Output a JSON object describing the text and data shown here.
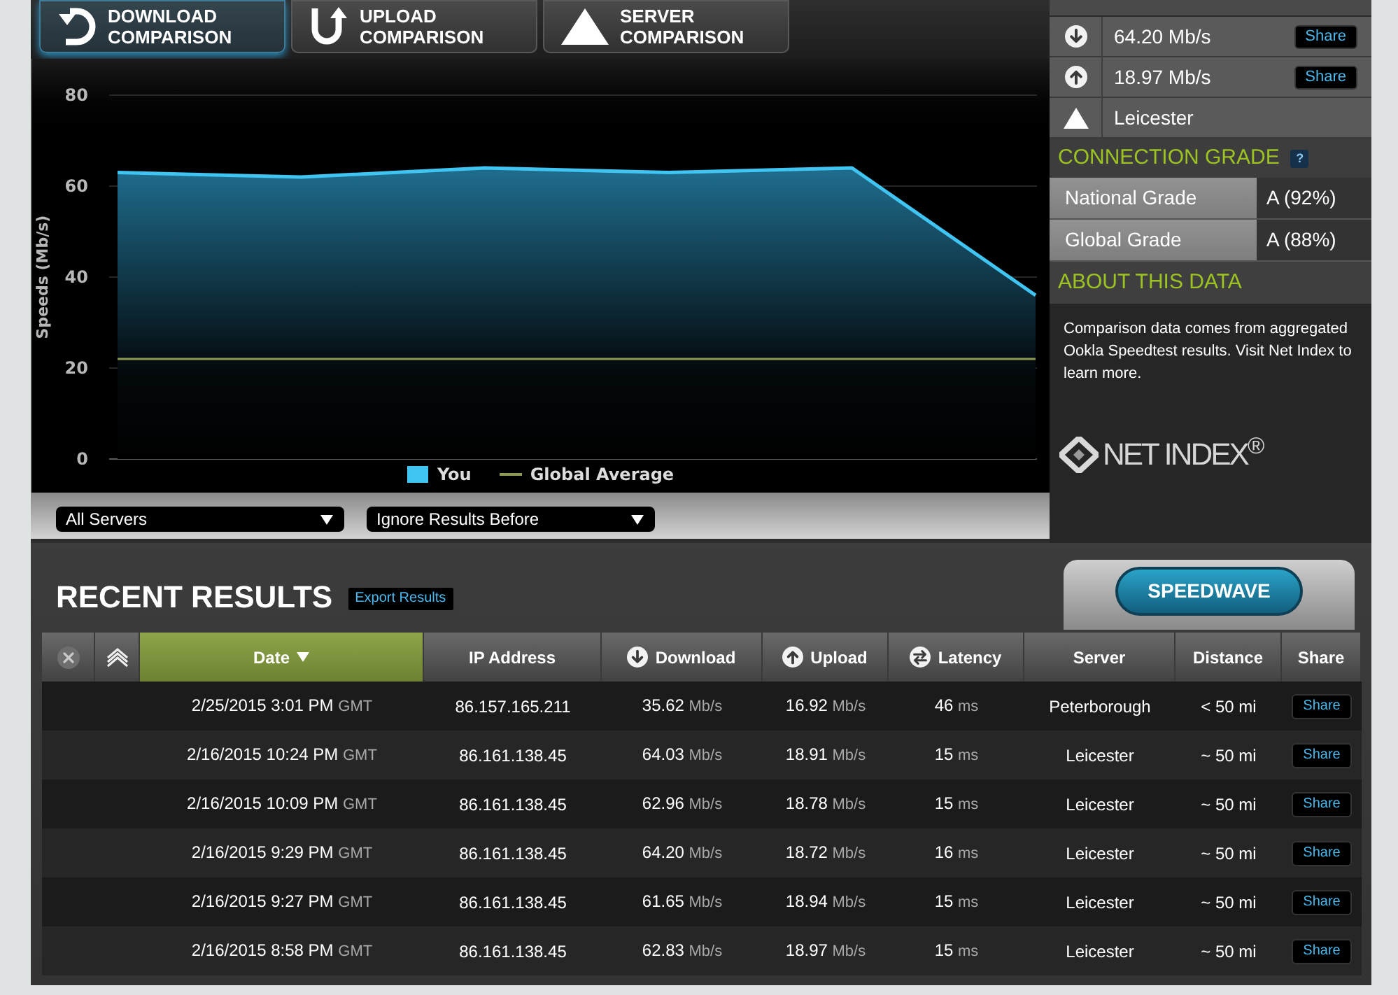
{
  "comparison_tabs": [
    {
      "kind": "download",
      "label": "DOWNLOAD COMPARISON",
      "selected": true
    },
    {
      "kind": "upload",
      "label": "UPLOAD COMPARISON",
      "selected": false
    },
    {
      "kind": "server",
      "label": "SERVER COMPARISON",
      "selected": false
    }
  ],
  "chart": {
    "chart_data": {
      "type": "area",
      "ylabel": "Speeds (Mb/s)",
      "ylim": [
        0,
        80
      ],
      "yticks": [
        0,
        20,
        40,
        60,
        80
      ],
      "grid": true,
      "legend": true,
      "series": [
        {
          "name": "You",
          "color": "#40c4f2",
          "values": [
            63,
            62,
            64,
            63,
            64,
            36
          ]
        },
        {
          "name": "Global Average",
          "type": "line",
          "color": "#8c9a52",
          "values": [
            22,
            22,
            22,
            22,
            22,
            22
          ]
        }
      ]
    }
  },
  "filters": [
    {
      "value": "All Servers"
    },
    {
      "value": "Ignore Results Before"
    }
  ],
  "summary": {
    "results": [
      {
        "kind": "download",
        "value": "64.20 Mb/s",
        "share": "Share"
      },
      {
        "kind": "upload",
        "value": "18.97 Mb/s",
        "share": "Share"
      },
      {
        "kind": "server",
        "value": "Leicester"
      }
    ]
  },
  "connection_grade": {
    "title": "CONNECTION GRADE",
    "help": "?",
    "grades": [
      {
        "label": "National Grade",
        "value": "A (92%)"
      },
      {
        "label": "Global Grade",
        "value": "A (88%)"
      }
    ]
  },
  "about": {
    "title": "ABOUT THIS DATA",
    "text": "Comparison data comes from aggregated Ookla Speedtest results. Visit Net Index to learn more.",
    "logo": "NET INDEX$^{®}$"
  },
  "recent_results": {
    "title": "RECENT RESULTS",
    "export": "Export Results",
    "speedwave": "SPEEDWAVE",
    "columns": [
      {
        "kind": "clear",
        "selected": false,
        "sorted": false
      },
      {
        "kind": "layers",
        "selected": false,
        "sorted": false
      },
      {
        "kind": "text",
        "label": "Date",
        "selected": true,
        "sorted": true
      },
      {
        "kind": "text",
        "label": "IP Address",
        "selected": false,
        "sorted": false
      },
      {
        "kind": "download",
        "label": "Download",
        "selected": false,
        "sorted": false
      },
      {
        "kind": "upload",
        "label": "Upload",
        "selected": false,
        "sorted": false
      },
      {
        "kind": "latency",
        "label": "Latency",
        "selected": false,
        "sorted": false
      },
      {
        "kind": "text",
        "label": "Server",
        "selected": false,
        "sorted": false
      },
      {
        "kind": "text",
        "label": "Distance",
        "selected": false,
        "sorted": false
      },
      {
        "kind": "text",
        "label": "Share",
        "selected": false,
        "sorted": false
      }
    ],
    "rows": [
      {
        "date": "2/25/2015 3:01 PM",
        "tz": "GMT",
        "ip": "86.157.165.211",
        "download": "35.62",
        "download_unit": "Mb/s",
        "upload": "16.92",
        "upload_unit": "Mb/s",
        "latency": "46",
        "latency_unit": "ms",
        "server": "Peterborough",
        "distance": "< 50 mi",
        "share": "Share"
      },
      {
        "date": "2/16/2015 10:24 PM",
        "tz": "GMT",
        "ip": "86.161.138.45",
        "download": "64.03",
        "download_unit": "Mb/s",
        "upload": "18.91",
        "upload_unit": "Mb/s",
        "latency": "15",
        "latency_unit": "ms",
        "server": "Leicester",
        "distance": "~ 50 mi",
        "share": "Share"
      },
      {
        "date": "2/16/2015 10:09 PM",
        "tz": "GMT",
        "ip": "86.161.138.45",
        "download": "62.96",
        "download_unit": "Mb/s",
        "upload": "18.78",
        "upload_unit": "Mb/s",
        "latency": "15",
        "latency_unit": "ms",
        "server": "Leicester",
        "distance": "~ 50 mi",
        "share": "Share"
      },
      {
        "date": "2/16/2015 9:29 PM",
        "tz": "GMT",
        "ip": "86.161.138.45",
        "download": "64.20",
        "download_unit": "Mb/s",
        "upload": "18.72",
        "upload_unit": "Mb/s",
        "latency": "16",
        "latency_unit": "ms",
        "server": "Leicester",
        "distance": "~ 50 mi",
        "share": "Share"
      },
      {
        "date": "2/16/2015 9:27 PM",
        "tz": "GMT",
        "ip": "86.161.138.45",
        "download": "61.65",
        "download_unit": "Mb/s",
        "upload": "18.94",
        "upload_unit": "Mb/s",
        "latency": "15",
        "latency_unit": "ms",
        "server": "Leicester",
        "distance": "~ 50 mi",
        "share": "Share"
      },
      {
        "date": "2/16/2015 8:58 PM",
        "tz": "GMT",
        "ip": "86.161.138.45",
        "download": "62.83",
        "download_unit": "Mb/s",
        "upload": "18.97",
        "upload_unit": "Mb/s",
        "latency": "15",
        "latency_unit": "ms",
        "server": "Leicester",
        "distance": "~ 50 mi",
        "share": "Share"
      }
    ]
  }
}
